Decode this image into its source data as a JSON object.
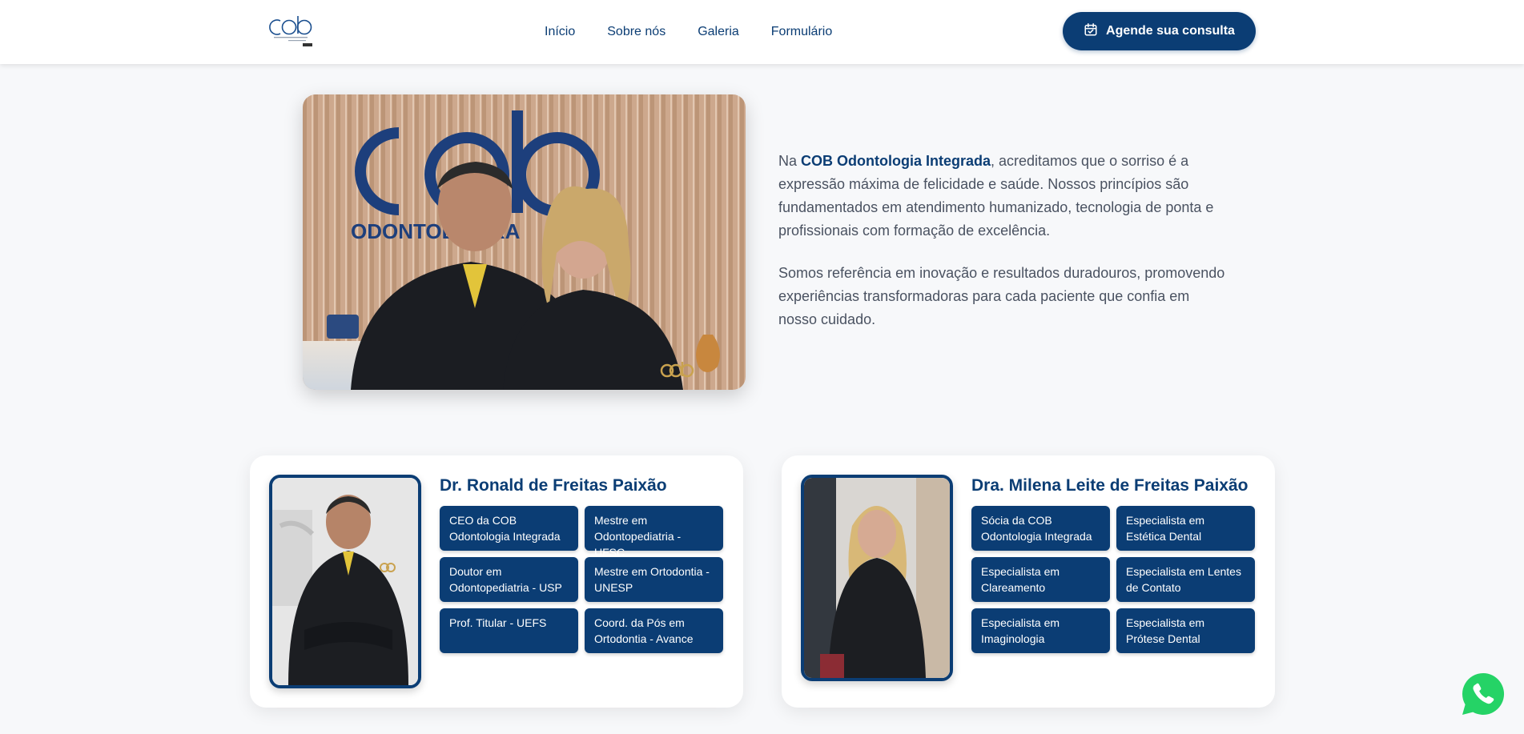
{
  "header": {
    "logo_alt": "COB Odontologia Integrada",
    "nav": [
      "Início",
      "Sobre nós",
      "Galeria",
      "Formulário"
    ],
    "cta_label": "Agende sua consulta"
  },
  "intro": {
    "p1_prefix": "Na ",
    "p1_brand": "COB Odontologia Integrada",
    "p1_suffix": ", acreditamos que o sorriso é a expressão máxima de felicidade e saúde. Nossos princípios são fundamentados em atendimento humanizado, tecnologia de ponta e profissionais com formação de excelência.",
    "p2": "Somos referência em inovação e resultados duradouros, promovendo experiências transformadoras para cada paciente que confia em nosso cuidado."
  },
  "profiles": [
    {
      "name": "Dr. Ronald de Freitas Paixão",
      "tags": [
        "CEO da COB Odontologia Integrada",
        "Mestre em Odontopediatria - UFSC",
        "Doutor em Odontopediatria - USP",
        "Mestre em Ortodontia - UNESP",
        "Prof. Titular - UEFS",
        "Coord. da Pós em Ortodontia - Avance"
      ]
    },
    {
      "name": "Dra. Milena Leite de Freitas Paixão",
      "tags": [
        "Sócia da COB Odontologia Integrada",
        "Especialista em Estética Dental",
        "Especialista em Clareamento",
        "Especialista em Lentes de Contato",
        "Especialista em Imaginologia",
        "Especialista em Prótese Dental"
      ]
    }
  ],
  "colors": {
    "brand": "#0b3d74",
    "background": "#f7f8fa",
    "whatsapp": "#25d366"
  },
  "icons": {
    "cta": "calendar-icon",
    "float": "whatsapp-icon"
  }
}
